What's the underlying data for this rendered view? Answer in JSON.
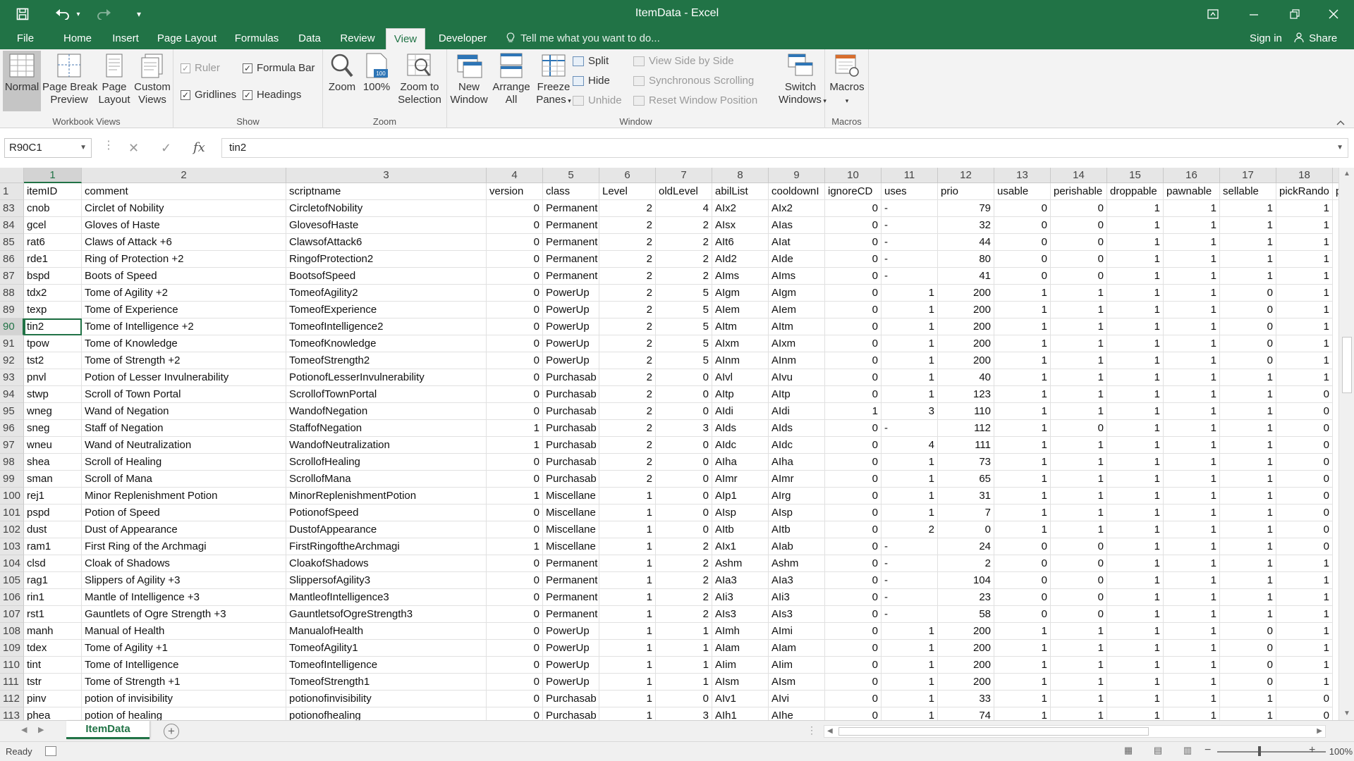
{
  "window": {
    "title": "ItemData - Excel"
  },
  "quick_access": {
    "save_icon": "save-icon",
    "undo_icon": "undo-icon",
    "redo_icon": "redo-icon",
    "customize_icon": "customize-icon"
  },
  "ribbon_tabs": [
    "File",
    "Home",
    "Insert",
    "Page Layout",
    "Formulas",
    "Data",
    "Review",
    "View",
    "Developer"
  ],
  "active_tab": "View",
  "tell_me": "Tell me what you want to do...",
  "sign_in": "Sign in",
  "share": "Share",
  "ribbon": {
    "workbook_views": {
      "label": "Workbook Views",
      "normal": "Normal",
      "page_break": [
        "Page Break",
        "Preview"
      ],
      "page_layout": [
        "Page",
        "Layout"
      ],
      "custom_views": [
        "Custom",
        "Views"
      ]
    },
    "show": {
      "label": "Show",
      "ruler": "Ruler",
      "formula_bar": "Formula Bar",
      "gridlines": "Gridlines",
      "headings": "Headings"
    },
    "zoom": {
      "label": "Zoom",
      "zoom": "Zoom",
      "hundred": "100%",
      "zoom_sel": [
        "Zoom to",
        "Selection"
      ]
    },
    "window": {
      "label": "Window",
      "new_window": [
        "New",
        "Window"
      ],
      "arrange_all": [
        "Arrange",
        "All"
      ],
      "freeze_panes": [
        "Freeze",
        "Panes"
      ],
      "split": "Split",
      "hide": "Hide",
      "unhide": "Unhide",
      "view_side": "View Side by Side",
      "sync_scroll": "Synchronous Scrolling",
      "reset_pos": "Reset Window Position",
      "switch_windows": [
        "Switch",
        "Windows"
      ]
    },
    "macros": {
      "label": "Macros",
      "macros": "Macros"
    }
  },
  "formula_bar": {
    "name_box": "R90C1",
    "content": "tin2"
  },
  "columns": [
    "1",
    "2",
    "3",
    "4",
    "5",
    "6",
    "7",
    "8",
    "9",
    "10",
    "11",
    "12",
    "13",
    "14",
    "15",
    "16",
    "17",
    "18"
  ],
  "partial_column": "",
  "header_row": {
    "num": "1",
    "cells": [
      "itemID",
      "comment",
      "scriptname",
      "version",
      "class",
      "Level",
      "oldLevel",
      "abilList",
      "cooldownI",
      "ignoreCD",
      "uses",
      "prio",
      "usable",
      "perishable",
      "droppable",
      "pawnable",
      "sellable",
      "pickRando",
      "po"
    ]
  },
  "rows": [
    {
      "num": "83",
      "cells": [
        "cnob",
        "Circlet of Nobility",
        "CircletofNobility",
        "0",
        "Permanent",
        "2",
        "4",
        "AIx2",
        "AIx2",
        "0",
        "-",
        "79",
        "0",
        "0",
        "1",
        "1",
        "1",
        "1"
      ]
    },
    {
      "num": "84",
      "cells": [
        "gcel",
        "Gloves of Haste",
        "GlovesofHaste",
        "0",
        "Permanent",
        "2",
        "2",
        "AIsx",
        "AIas",
        "0",
        "-",
        "32",
        "0",
        "0",
        "1",
        "1",
        "1",
        "1"
      ]
    },
    {
      "num": "85",
      "cells": [
        "rat6",
        "Claws of Attack +6",
        "ClawsofAttack6",
        "0",
        "Permanent",
        "2",
        "2",
        "AIt6",
        "AIat",
        "0",
        "-",
        "44",
        "0",
        "0",
        "1",
        "1",
        "1",
        "1"
      ]
    },
    {
      "num": "86",
      "cells": [
        "rde1",
        "Ring of Protection +2",
        "RingofProtection2",
        "0",
        "Permanent",
        "2",
        "2",
        "AId2",
        "AIde",
        "0",
        "-",
        "80",
        "0",
        "0",
        "1",
        "1",
        "1",
        "1"
      ]
    },
    {
      "num": "87",
      "cells": [
        "bspd",
        "Boots of Speed",
        "BootsofSpeed",
        "0",
        "Permanent",
        "2",
        "2",
        "AIms",
        "AIms",
        "0",
        "-",
        "41",
        "0",
        "0",
        "1",
        "1",
        "1",
        "1"
      ]
    },
    {
      "num": "88",
      "cells": [
        "tdx2",
        "Tome of Agility +2",
        "TomeofAgility2",
        "0",
        "PowerUp",
        "2",
        "5",
        "AIgm",
        "AIgm",
        "0",
        "1",
        "200",
        "1",
        "1",
        "1",
        "1",
        "0",
        "1"
      ]
    },
    {
      "num": "89",
      "cells": [
        "texp",
        "Tome of Experience",
        "TomeofExperience",
        "0",
        "PowerUp",
        "2",
        "5",
        "AIem",
        "AIem",
        "0",
        "1",
        "200",
        "1",
        "1",
        "1",
        "1",
        "0",
        "1"
      ]
    },
    {
      "num": "90",
      "cells": [
        "tin2",
        "Tome of Intelligence +2",
        "TomeofIntelligence2",
        "0",
        "PowerUp",
        "2",
        "5",
        "AItm",
        "AItm",
        "0",
        "1",
        "200",
        "1",
        "1",
        "1",
        "1",
        "0",
        "1"
      ]
    },
    {
      "num": "91",
      "cells": [
        "tpow",
        "Tome of Knowledge",
        "TomeofKnowledge",
        "0",
        "PowerUp",
        "2",
        "5",
        "AIxm",
        "AIxm",
        "0",
        "1",
        "200",
        "1",
        "1",
        "1",
        "1",
        "0",
        "1"
      ]
    },
    {
      "num": "92",
      "cells": [
        "tst2",
        "Tome of Strength +2",
        "TomeofStrength2",
        "0",
        "PowerUp",
        "2",
        "5",
        "AInm",
        "AInm",
        "0",
        "1",
        "200",
        "1",
        "1",
        "1",
        "1",
        "0",
        "1"
      ]
    },
    {
      "num": "93",
      "cells": [
        "pnvl",
        "Potion of Lesser Invulnerability",
        "PotionofLesserInvulnerability",
        "0",
        "Purchasab",
        "2",
        "0",
        "AIvl",
        "AIvu",
        "0",
        "1",
        "40",
        "1",
        "1",
        "1",
        "1",
        "1",
        "1"
      ]
    },
    {
      "num": "94",
      "cells": [
        "stwp",
        "Scroll of Town Portal",
        "ScrollofTownPortal",
        "0",
        "Purchasab",
        "2",
        "0",
        "AItp",
        "AItp",
        "0",
        "1",
        "123",
        "1",
        "1",
        "1",
        "1",
        "1",
        "0"
      ]
    },
    {
      "num": "95",
      "cells": [
        "wneg",
        "Wand of Negation",
        "WandofNegation",
        "0",
        "Purchasab",
        "2",
        "0",
        "AIdi",
        "AIdi",
        "1",
        "3",
        "110",
        "1",
        "1",
        "1",
        "1",
        "1",
        "0"
      ]
    },
    {
      "num": "96",
      "cells": [
        "sneg",
        "Staff of Negation",
        "StaffofNegation",
        "1",
        "Purchasab",
        "2",
        "3",
        "AIds",
        "AIds",
        "0",
        "-",
        "112",
        "1",
        "0",
        "1",
        "1",
        "1",
        "0"
      ]
    },
    {
      "num": "97",
      "cells": [
        "wneu",
        "Wand of Neutralization",
        "WandofNeutralization",
        "1",
        "Purchasab",
        "2",
        "0",
        "AIdc",
        "AIdc",
        "0",
        "4",
        "111",
        "1",
        "1",
        "1",
        "1",
        "1",
        "0"
      ]
    },
    {
      "num": "98",
      "cells": [
        "shea",
        "Scroll of Healing",
        "ScrollofHealing",
        "0",
        "Purchasab",
        "2",
        "0",
        "AIha",
        "AIha",
        "0",
        "1",
        "73",
        "1",
        "1",
        "1",
        "1",
        "1",
        "0"
      ]
    },
    {
      "num": "99",
      "cells": [
        "sman",
        "Scroll of Mana",
        "ScrollofMana",
        "0",
        "Purchasab",
        "2",
        "0",
        "AImr",
        "AImr",
        "0",
        "1",
        "65",
        "1",
        "1",
        "1",
        "1",
        "1",
        "0"
      ]
    },
    {
      "num": "100",
      "cells": [
        "rej1",
        "Minor Replenishment Potion",
        "MinorReplenishmentPotion",
        "1",
        "Miscellane",
        "1",
        "0",
        "AIp1",
        "AIrg",
        "0",
        "1",
        "31",
        "1",
        "1",
        "1",
        "1",
        "1",
        "0"
      ]
    },
    {
      "num": "101",
      "cells": [
        "pspd",
        "Potion of Speed",
        "PotionofSpeed",
        "0",
        "Miscellane",
        "1",
        "0",
        "AIsp",
        "AIsp",
        "0",
        "1",
        "7",
        "1",
        "1",
        "1",
        "1",
        "1",
        "0"
      ]
    },
    {
      "num": "102",
      "cells": [
        "dust",
        "Dust of Appearance",
        "DustofAppearance",
        "0",
        "Miscellane",
        "1",
        "0",
        "AItb",
        "AItb",
        "0",
        "2",
        "0",
        "1",
        "1",
        "1",
        "1",
        "1",
        "0"
      ]
    },
    {
      "num": "103",
      "cells": [
        "ram1",
        "First Ring of the Archmagi",
        "FirstRingoftheArchmagi",
        "1",
        "Miscellane",
        "1",
        "2",
        "AIx1",
        "AIab",
        "0",
        "-",
        "24",
        "0",
        "0",
        "1",
        "1",
        "1",
        "0"
      ]
    },
    {
      "num": "104",
      "cells": [
        "clsd",
        "Cloak of Shadows",
        "CloakofShadows",
        "0",
        "Permanent",
        "1",
        "2",
        "Ashm",
        "Ashm",
        "0",
        "-",
        "2",
        "0",
        "0",
        "1",
        "1",
        "1",
        "1"
      ]
    },
    {
      "num": "105",
      "cells": [
        "rag1",
        "Slippers of Agility +3",
        "SlippersofAgility3",
        "0",
        "Permanent",
        "1",
        "2",
        "AIa3",
        "AIa3",
        "0",
        "-",
        "104",
        "0",
        "0",
        "1",
        "1",
        "1",
        "1"
      ]
    },
    {
      "num": "106",
      "cells": [
        "rin1",
        "Mantle of Intelligence +3",
        "MantleofIntelligence3",
        "0",
        "Permanent",
        "1",
        "2",
        "AIi3",
        "AIi3",
        "0",
        "-",
        "23",
        "0",
        "0",
        "1",
        "1",
        "1",
        "1"
      ]
    },
    {
      "num": "107",
      "cells": [
        "rst1",
        "Gauntlets of Ogre Strength +3",
        "GauntletsofOgreStrength3",
        "0",
        "Permanent",
        "1",
        "2",
        "AIs3",
        "AIs3",
        "0",
        "-",
        "58",
        "0",
        "0",
        "1",
        "1",
        "1",
        "1"
      ]
    },
    {
      "num": "108",
      "cells": [
        "manh",
        "Manual of Health",
        "ManualofHealth",
        "0",
        "PowerUp",
        "1",
        "1",
        "AImh",
        "AImi",
        "0",
        "1",
        "200",
        "1",
        "1",
        "1",
        "1",
        "0",
        "1"
      ]
    },
    {
      "num": "109",
      "cells": [
        "tdex",
        "Tome of Agility +1",
        "TomeofAgility1",
        "0",
        "PowerUp",
        "1",
        "1",
        "AIam",
        "AIam",
        "0",
        "1",
        "200",
        "1",
        "1",
        "1",
        "1",
        "0",
        "1"
      ]
    },
    {
      "num": "110",
      "cells": [
        "tint",
        "Tome of Intelligence",
        "TomeofIntelligence",
        "0",
        "PowerUp",
        "1",
        "1",
        "AIim",
        "AIim",
        "0",
        "1",
        "200",
        "1",
        "1",
        "1",
        "1",
        "0",
        "1"
      ]
    },
    {
      "num": "111",
      "cells": [
        "tstr",
        "Tome of Strength +1",
        "TomeofStrength1",
        "0",
        "PowerUp",
        "1",
        "1",
        "AIsm",
        "AIsm",
        "0",
        "1",
        "200",
        "1",
        "1",
        "1",
        "1",
        "0",
        "1"
      ]
    },
    {
      "num": "112",
      "cells": [
        "pinv",
        "potion of invisibility",
        "potionofinvisibility",
        "0",
        "Purchasab",
        "1",
        "0",
        "AIv1",
        "AIvi",
        "0",
        "1",
        "33",
        "1",
        "1",
        "1",
        "1",
        "1",
        "0"
      ]
    },
    {
      "num": "113",
      "cells": [
        "phea",
        "potion of healing",
        "potionofhealing",
        "0",
        "Purchasab",
        "1",
        "3",
        "AIh1",
        "AIhe",
        "0",
        "1",
        "74",
        "1",
        "1",
        "1",
        "1",
        "1",
        "0"
      ]
    }
  ],
  "active_cell": {
    "row": "90",
    "col": 0
  },
  "sheet_tab": "ItemData",
  "status": {
    "ready": "Ready",
    "zoom": "100%"
  },
  "colors": {
    "accent": "#217346"
  }
}
